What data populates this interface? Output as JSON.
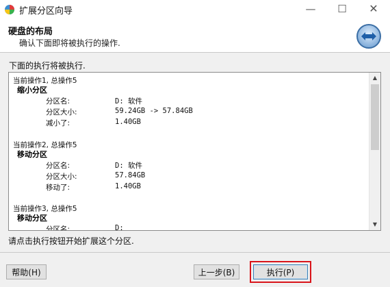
{
  "window": {
    "title": "扩展分区向导",
    "minimize_glyph": "—",
    "maximize_glyph": "☐",
    "close_glyph": "✕"
  },
  "header": {
    "title": "硬盘的布局",
    "subtitle": "确认下面即将被执行的操作."
  },
  "intro_text": "下面的执行将被执行.",
  "operations": [
    {
      "heading": "当前操作1, 总操作5",
      "title": "缩小分区",
      "rows": [
        {
          "key": "分区名:",
          "value": "D: 软件"
        },
        {
          "key": "分区大小:",
          "value": "59.24GB -> 57.84GB"
        },
        {
          "key": "减小了:",
          "value": "1.40GB"
        }
      ]
    },
    {
      "heading": "当前操作2, 总操作5",
      "title": "移动分区",
      "rows": [
        {
          "key": "分区名:",
          "value": "D: 软件"
        },
        {
          "key": "分区大小:",
          "value": "57.84GB"
        },
        {
          "key": "移动了:",
          "value": "1.40GB"
        }
      ]
    },
    {
      "heading": "当前操作3, 总操作5",
      "title": "移动分区",
      "rows": [
        {
          "key": "分区名:",
          "value": "D:"
        }
      ]
    }
  ],
  "status_text": "请点击执行按钮开始扩展这个分区.",
  "buttons": {
    "help": "帮助(H)",
    "back": "上一步(B)",
    "execute": "执行(P)"
  },
  "colors": {
    "highlight": "#d9141a",
    "dialog_bg": "#f0f0f0"
  }
}
